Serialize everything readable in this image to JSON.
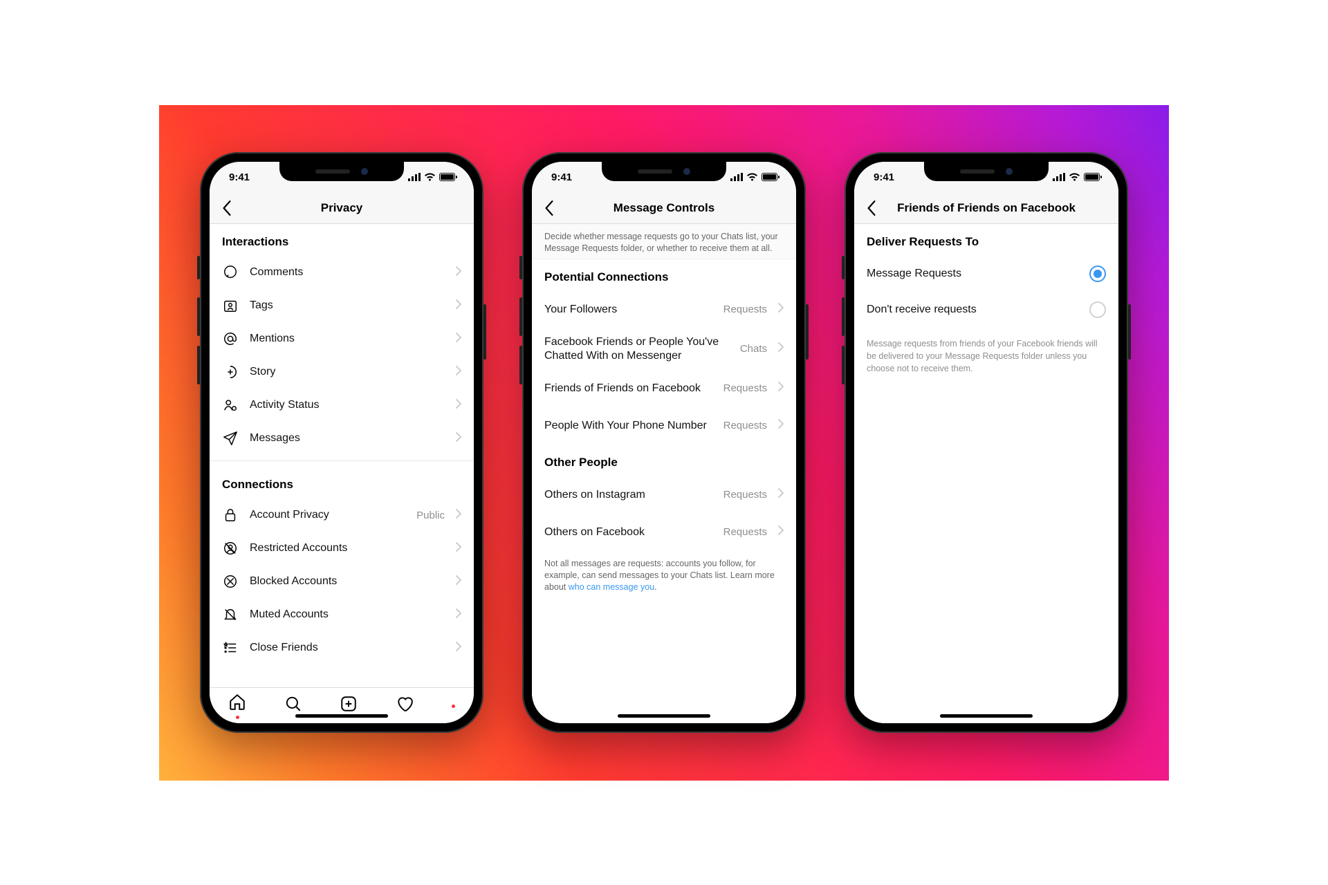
{
  "status": {
    "time": "9:41"
  },
  "phone1": {
    "title": "Privacy",
    "sections": {
      "interactions": "Interactions",
      "connections": "Connections"
    },
    "rows": {
      "comments": "Comments",
      "tags": "Tags",
      "mentions": "Mentions",
      "story": "Story",
      "activity": "Activity Status",
      "messages": "Messages",
      "accountPrivacy": "Account Privacy",
      "accountPrivacyValue": "Public",
      "restricted": "Restricted Accounts",
      "blocked": "Blocked Accounts",
      "muted": "Muted Accounts",
      "closeFriends": "Close Friends"
    }
  },
  "phone2": {
    "title": "Message Controls",
    "intro": "Decide whether message requests go to your Chats list, your Message Requests folder, or whether to receive them at all.",
    "sections": {
      "potential": "Potential Connections",
      "other": "Other People"
    },
    "rows": {
      "followers": {
        "label": "Your Followers",
        "value": "Requests"
      },
      "fbfriends": {
        "label": "Facebook Friends or People You've Chatted With on Messenger",
        "value": "Chats"
      },
      "fof": {
        "label": "Friends of Friends on Facebook",
        "value": "Requests"
      },
      "phone": {
        "label": "People With Your Phone Number",
        "value": "Requests"
      },
      "othersIg": {
        "label": "Others on Instagram",
        "value": "Requests"
      },
      "othersFb": {
        "label": "Others on Facebook",
        "value": "Requests"
      }
    },
    "footer": {
      "text": "Not all messages are requests: accounts you follow, for example, can send messages to your Chats list. Learn more about ",
      "link": "who can message you",
      "after": "."
    }
  },
  "phone3": {
    "title": "Friends of Friends on Facebook",
    "section": "Deliver Requests To",
    "options": {
      "msgReq": "Message Requests",
      "dont": "Don't receive requests"
    },
    "note": "Message requests from friends of your Facebook friends will be delivered to your Message Requests folder unless you choose not to receive them."
  }
}
